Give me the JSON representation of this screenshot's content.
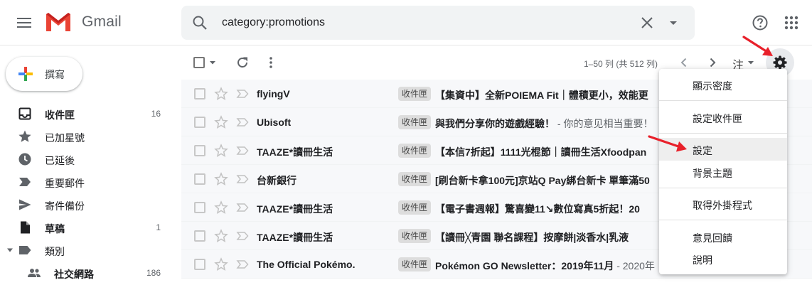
{
  "header": {
    "app_name": "Gmail",
    "search_value": "category:promotions"
  },
  "sidebar": {
    "compose_label": "撰寫",
    "items": [
      {
        "label": "收件匣",
        "count": "16",
        "icon": "inbox-icon"
      },
      {
        "label": "已加星號",
        "count": "",
        "icon": "star-icon"
      },
      {
        "label": "已延後",
        "count": "",
        "icon": "clock-icon"
      },
      {
        "label": "重要郵件",
        "count": "",
        "icon": "important-icon"
      },
      {
        "label": "寄件備份",
        "count": "",
        "icon": "send-icon"
      },
      {
        "label": "草稿",
        "count": "1",
        "icon": "draft-icon"
      },
      {
        "label": "類別",
        "count": "",
        "icon": "label-icon"
      },
      {
        "label": "社交網路",
        "count": "186",
        "icon": "people-icon"
      }
    ]
  },
  "toolbar": {
    "range": "1–50 列 (共 512 列)",
    "input_tool": "注"
  },
  "emails": [
    {
      "sender": "flyingV",
      "label": "收件匣",
      "subject": "【集資中】全新POIEMA Fit｜體積更小，效能更",
      "snippet": ""
    },
    {
      "sender": "Ubisoft",
      "label": "收件匣",
      "subject": "與我們分享你的遊戲經驗！",
      "snippet": " - 你的意见相当重要！"
    },
    {
      "sender": "TAAZE*讀冊生活",
      "label": "收件匣",
      "subject": "【本信7折起】1111光棍節｜讀冊生活Xfoodpan",
      "snippet": ""
    },
    {
      "sender": "台新銀行",
      "label": "收件匣",
      "subject": "[刷台新卡拿100元]京站Q Pay綁台新卡 單筆滿50",
      "snippet": ""
    },
    {
      "sender": "TAAZE*讀冊生活",
      "label": "收件匣",
      "subject": "【電子書週報】驚喜變11↘數位寫真5折起！20",
      "snippet": ""
    },
    {
      "sender": "TAAZE*讀冊生活",
      "label": "收件匣",
      "subject": "【讀冊╳青園 聯名課程】按摩餅|淡香水|乳液",
      "snippet": ""
    },
    {
      "sender": "The Official Pokémo.",
      "label": "收件匣",
      "subject": "Pokémon GO Newsletter：2019年11月",
      "snippet": " - 2020年"
    }
  ],
  "settings_menu": {
    "items": [
      "顯示密度",
      "設定收件匣",
      "設定",
      "背景主題",
      "取得外掛程式",
      "意見回饋",
      "說明"
    ],
    "highlighted": "設定"
  },
  "colors": {
    "gmail_red": "#ea4335",
    "annotation_arrow": "#e8202a"
  }
}
